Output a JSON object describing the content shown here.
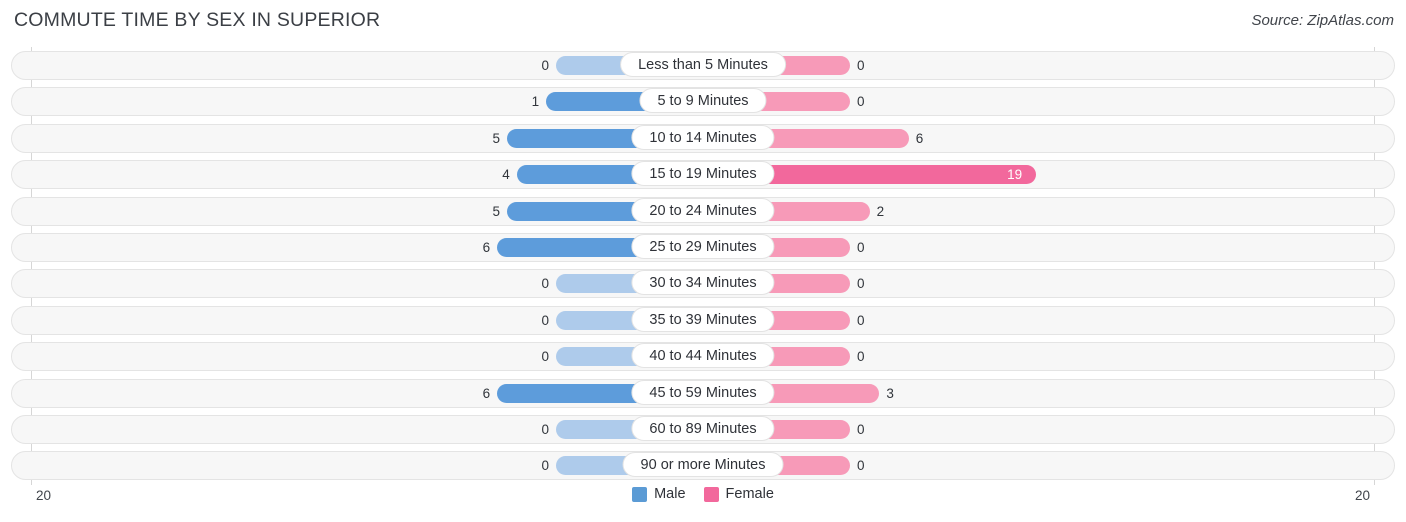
{
  "header": {
    "title": "COMMUTE TIME BY SEX IN SUPERIOR",
    "source": "Source: ZipAtlas.com"
  },
  "axis": {
    "left_label": "20",
    "right_label": "20",
    "max": 20
  },
  "legend": [
    {
      "label": "Male",
      "color": "#5b9bd5"
    },
    {
      "label": "Female",
      "color": "#f2689c"
    }
  ],
  "colors": {
    "male": "#5d9cdb",
    "male_zero": "#aecbeb",
    "female": "#f79ab8",
    "female_max": "#f2689c",
    "track": "#f7f7f7",
    "track_border": "#e4e4e4",
    "axis": "#d6d6d6"
  },
  "chart_data": {
    "type": "bar",
    "title": "COMMUTE TIME BY SEX IN SUPERIOR",
    "subtitle": "Source: ZipAtlas.com",
    "orientation": "horizontal-diverging",
    "xlabel": "",
    "ylabel": "",
    "xlim": [
      -20,
      20
    ],
    "axis_tick_labels": [
      "20",
      "20"
    ],
    "grid": false,
    "legend_position": "bottom-center",
    "categories": [
      "Less than 5 Minutes",
      "5 to 9 Minutes",
      "10 to 14 Minutes",
      "15 to 19 Minutes",
      "20 to 24 Minutes",
      "25 to 29 Minutes",
      "30 to 34 Minutes",
      "35 to 39 Minutes",
      "40 to 44 Minutes",
      "45 to 59 Minutes",
      "60 to 89 Minutes",
      "90 or more Minutes"
    ],
    "series": [
      {
        "name": "Male",
        "side": "left",
        "color": "#5d9cdb",
        "values": [
          0,
          1,
          5,
          4,
          5,
          6,
          0,
          0,
          0,
          6,
          0,
          0
        ]
      },
      {
        "name": "Female",
        "side": "right",
        "color": "#f79ab8",
        "values": [
          0,
          0,
          6,
          19,
          2,
          0,
          0,
          0,
          0,
          3,
          0,
          0
        ]
      }
    ],
    "rows": [
      {
        "label": "Less than 5 Minutes",
        "male": 0,
        "female": 0
      },
      {
        "label": "5 to 9 Minutes",
        "male": 1,
        "female": 0
      },
      {
        "label": "10 to 14 Minutes",
        "male": 5,
        "female": 6
      },
      {
        "label": "15 to 19 Minutes",
        "male": 4,
        "female": 19
      },
      {
        "label": "20 to 24 Minutes",
        "male": 5,
        "female": 2
      },
      {
        "label": "25 to 29 Minutes",
        "male": 6,
        "female": 0
      },
      {
        "label": "30 to 34 Minutes",
        "male": 0,
        "female": 0
      },
      {
        "label": "35 to 39 Minutes",
        "male": 0,
        "female": 0
      },
      {
        "label": "40 to 44 Minutes",
        "male": 0,
        "female": 0
      },
      {
        "label": "45 to 59 Minutes",
        "male": 6,
        "female": 3
      },
      {
        "label": "60 to 89 Minutes",
        "male": 0,
        "female": 0
      },
      {
        "label": "90 or more Minutes",
        "male": 0,
        "female": 0
      }
    ]
  }
}
